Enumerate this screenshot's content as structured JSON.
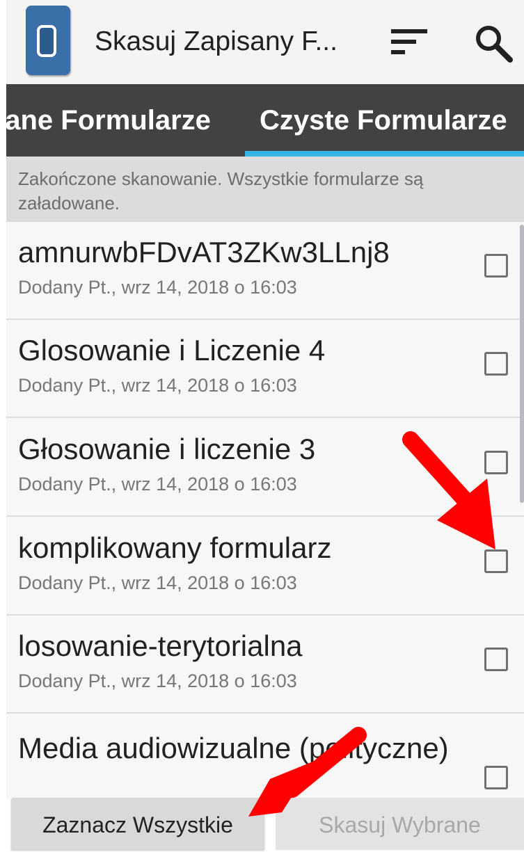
{
  "app": {
    "title": "Skasuj Zapisany F...",
    "icon": "app-logo-icon"
  },
  "toolbar": {
    "sort_icon": "sort-icon",
    "search_icon": "search-icon"
  },
  "tabs": [
    {
      "label": "sane Formularze",
      "selected": false
    },
    {
      "label": "Czyste Formularze",
      "selected": true
    }
  ],
  "status_message": "Zakończone skanowanie. Wszystkie formularze są załadowane.",
  "forms": [
    {
      "name": "amnurwbFDvAT3ZKw3LLnj8",
      "added": "Dodany Pt., wrz 14, 2018 o 16:03",
      "checked": false
    },
    {
      "name": "Glosowanie i Liczenie 4",
      "added": "Dodany Pt., wrz 14, 2018 o 16:03",
      "checked": false
    },
    {
      "name": "Głosowanie i liczenie 3",
      "added": "Dodany Pt., wrz 14, 2018 o 16:03",
      "checked": false
    },
    {
      "name": "komplikowany formularz",
      "added": "Dodany Pt., wrz 14, 2018 o 16:03",
      "checked": false
    },
    {
      "name": "losowanie-terytorialna",
      "added": "Dodany Pt., wrz 14, 2018 o 16:03",
      "checked": false
    },
    {
      "name": "Media audiowizualne (polityczne)",
      "added": "",
      "checked": false
    }
  ],
  "buttons": {
    "select_all": "Zaznacz Wszystkie",
    "delete_selected": "Skasuj Wybrane"
  },
  "colors": {
    "tab_indicator": "#33b5e5",
    "tab_bar": "#424242",
    "annotation_arrow": "#ff0000"
  }
}
